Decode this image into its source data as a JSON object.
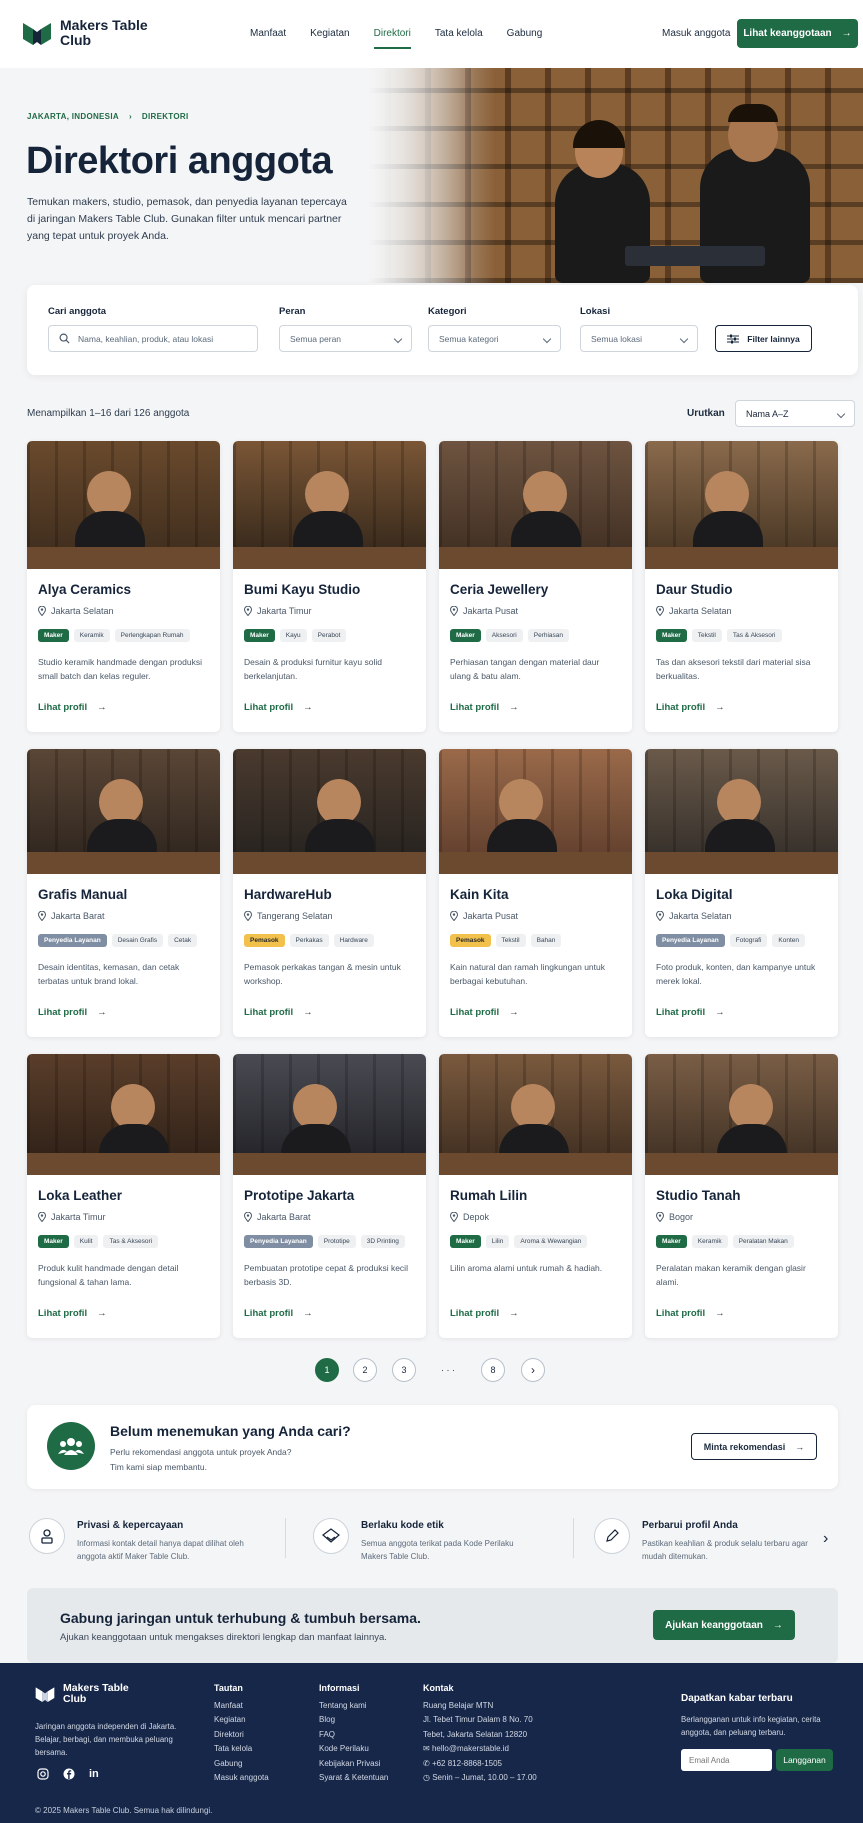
{
  "brand": {
    "name": "Makers Table Club"
  },
  "nav": {
    "items": [
      "Manfaat",
      "Kegiatan",
      "Direktori",
      "Tata kelola",
      "Gabung"
    ],
    "login": "Masuk anggota",
    "cta": "Lihat keanggotaan"
  },
  "hero": {
    "breadcrumb": [
      "JAKARTA, INDONESIA",
      "DIREKTORI"
    ],
    "title": "Direktori anggota",
    "lead": "Temukan makers, studio, pemasok, dan penyedia layanan tepercaya di jaringan Makers Table Club. Gunakan filter untuk mencari partner yang tepat untuk proyek Anda."
  },
  "filters": {
    "search_label": "Cari anggota",
    "search_placeholder": "Nama, keahlian, produk, atau lokasi",
    "role_label": "Peran",
    "role_value": "Semua peran",
    "category_label": "Kategori",
    "category_value": "Semua kategori",
    "location_label": "Lokasi",
    "location_value": "Semua lokasi",
    "more": "Filter lainnya"
  },
  "results": {
    "count": "Menampilkan 1–16 dari 126 anggota",
    "sort_label": "Urutkan",
    "sort_value": "Nama A–Z",
    "link_label": "Lihat profil"
  },
  "members": [
    {
      "name": "Alya Ceramics",
      "location": "Jakarta Selatan",
      "tags": [
        "Maker",
        "Keramik",
        "Perlengkapan Rumah"
      ],
      "desc": "Studio keramik handmade dengan produksi small batch dan kelas reguler."
    },
    {
      "name": "Bumi Kayu Studio",
      "location": "Jakarta Timur",
      "tags": [
        "Maker",
        "Kayu",
        "Perabot"
      ],
      "desc": "Desain & produksi furnitur kayu solid berkelanjutan."
    },
    {
      "name": "Ceria Jewellery",
      "location": "Jakarta Pusat",
      "tags": [
        "Maker",
        "Aksesori",
        "Perhiasan"
      ],
      "desc": "Perhiasan tangan dengan material daur ulang & batu alam."
    },
    {
      "name": "Daur Studio",
      "location": "Jakarta Selatan",
      "tags": [
        "Maker",
        "Tekstil",
        "Tas & Aksesori"
      ],
      "desc": "Tas dan aksesori tekstil dari material sisa berkualitas."
    },
    {
      "name": "Grafis Manual",
      "location": "Jakarta Barat",
      "tags": [
        "Penyedia Layanan",
        "Desain Grafis",
        "Cetak"
      ],
      "desc": "Desain identitas, kemasan, dan cetak terbatas untuk brand lokal."
    },
    {
      "name": "HardwareHub",
      "location": "Tangerang Selatan",
      "tags": [
        "Pemasok",
        "Perkakas",
        "Hardware"
      ],
      "desc": "Pemasok perkakas tangan & mesin untuk workshop."
    },
    {
      "name": "Kain Kita",
      "location": "Jakarta Pusat",
      "tags": [
        "Pemasok",
        "Tekstil",
        "Bahan"
      ],
      "desc": "Kain natural dan ramah lingkungan untuk berbagai kebutuhan."
    },
    {
      "name": "Loka Digital",
      "location": "Jakarta Selatan",
      "tags": [
        "Penyedia Layanan",
        "Fotografi",
        "Konten"
      ],
      "desc": "Foto produk, konten, dan kampanye untuk merek lokal."
    },
    {
      "name": "Loka Leather",
      "location": "Jakarta Timur",
      "tags": [
        "Maker",
        "Kulit",
        "Tas & Aksesori"
      ],
      "desc": "Produk kulit handmade dengan detail fungsional & tahan lama."
    },
    {
      "name": "Prototipe Jakarta",
      "location": "Jakarta Barat",
      "tags": [
        "Penyedia Layanan",
        "Prototipe",
        "3D Printing"
      ],
      "desc": "Pembuatan prototipe cepat & produksi kecil berbasis 3D."
    },
    {
      "name": "Rumah Lilin",
      "location": "Depok",
      "tags": [
        "Maker",
        "Lilin",
        "Aroma & Wewangian"
      ],
      "desc": "Lilin aroma alami untuk rumah & hadiah."
    },
    {
      "name": "Studio Tanah",
      "location": "Bogor",
      "tags": [
        "Maker",
        "Keramik",
        "Peralatan Makan"
      ],
      "desc": "Peralatan makan keramik dengan glasir alami."
    }
  ],
  "pagination": [
    "1",
    "2",
    "3",
    "· · ·",
    "8"
  ],
  "recommend": {
    "title": "Belum menemukan yang Anda cari?",
    "text1": "Perlu rekomendasi anggota untuk proyek Anda?",
    "text2": "Tim kami siap membantu.",
    "button": "Minta rekomendasi"
  },
  "features": [
    {
      "title": "Privasi & kepercayaan",
      "desc": "Informasi kontak detail hanya dapat dilihat oleh anggota aktif Maker Table Club."
    },
    {
      "title": "Berlaku kode etik",
      "desc": "Semua anggota terikat pada Kode Perilaku Makers Table Club."
    },
    {
      "title": "Perbarui profil Anda",
      "desc": "Pastikan keahlian & produk selalu terbaru agar mudah ditemukan."
    }
  ],
  "cta": {
    "title": "Gabung jaringan untuk terhubung & tumbuh bersama.",
    "text": "Ajukan keanggotaan untuk mengakses direktori lengkap dan manfaat lainnya.",
    "button": "Ajukan keanggotaan"
  },
  "footer": {
    "about": "Jaringan anggota independen di Jakarta. Belajar, berbagi, dan membuka peluang bersama.",
    "col1_title": "Tautan",
    "col1": [
      "Manfaat",
      "Kegiatan",
      "Direktori",
      "Tata kelola",
      "Gabung",
      "Masuk anggota"
    ],
    "col2_title": "Informasi",
    "col2": [
      "Tentang kami",
      "Blog",
      "FAQ",
      "Kode Perilaku",
      "Kebijakan Privasi",
      "Syarat & Ketentuan"
    ],
    "contact_title": "Kontak",
    "address": [
      "Ruang Belajar MTN",
      "Jl. Tebet Timur Dalam 8 No. 70",
      "Tebet, Jakarta Selatan 12820"
    ],
    "email": "hello@makerstable.id",
    "phone": "+62 812-8868-1505",
    "hours": "Senin – Jumat, 10.00 – 17.00",
    "newsletter_title": "Dapatkan kabar terbaru",
    "newsletter_text": "Berlangganan untuk info kegiatan, cerita anggota, dan peluang terbaru.",
    "email_placeholder": "Email Anda",
    "subscribe": "Langganan",
    "copyright": "© 2025 Makers Table Club. Semua hak dilindungi."
  }
}
